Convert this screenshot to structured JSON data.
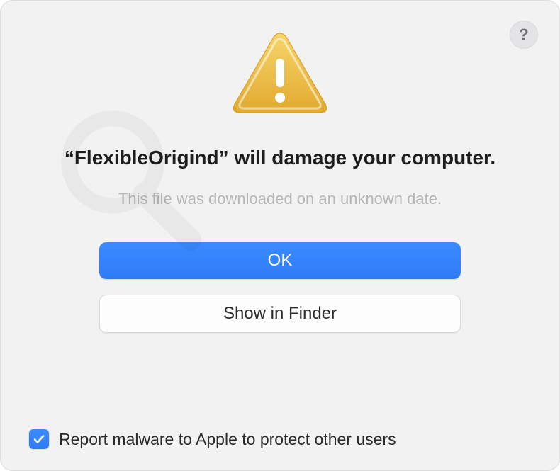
{
  "help": {
    "label": "?"
  },
  "icon": {
    "name": "warning-icon"
  },
  "headline": "“FlexibleOrigind” will damage your computer.",
  "subtext": "This file was downloaded on an unknown date.",
  "buttons": {
    "primary": "OK",
    "secondary": "Show in Finder"
  },
  "checkbox": {
    "checked": true,
    "label": "Report malware to Apple to protect other users"
  }
}
